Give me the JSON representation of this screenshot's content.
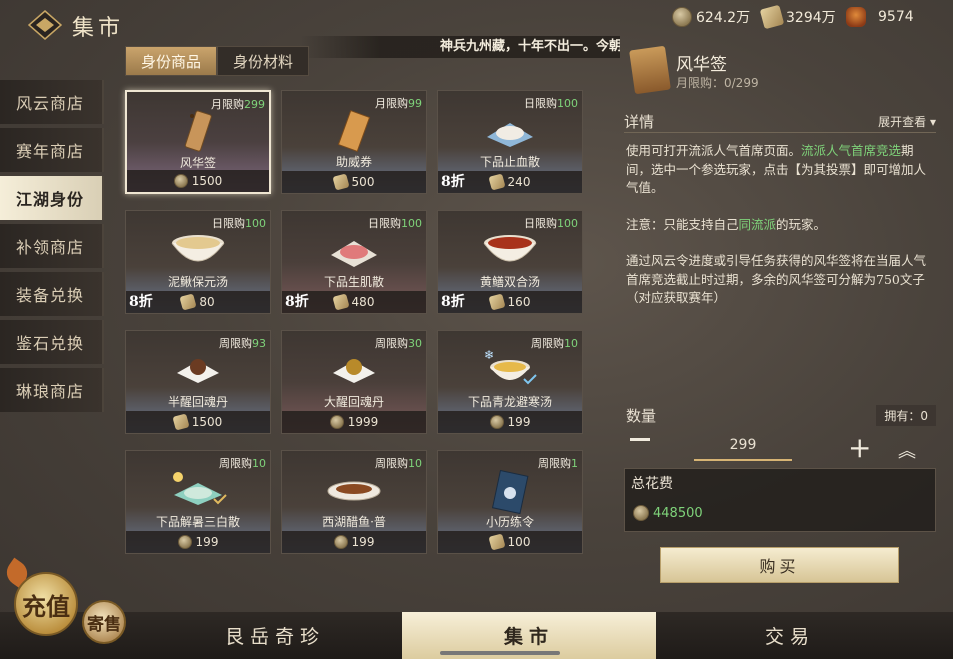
{
  "header": {
    "title": "集市",
    "currencies": [
      {
        "icon": "coin-icon",
        "value": "624.2万"
      },
      {
        "icon": "ticket-icon",
        "value": "3294万"
      },
      {
        "icon": "bag-icon",
        "value": "9574"
      }
    ]
  },
  "marquee": "神兵九州藏，十年不出一。今朝石破天惊",
  "sidebar": {
    "items": [
      {
        "label": "风云商店"
      },
      {
        "label": "赛年商店"
      },
      {
        "label": "江湖身份",
        "active": true
      },
      {
        "label": "补领商店"
      },
      {
        "label": "装备兑换"
      },
      {
        "label": "鉴石兑换"
      },
      {
        "label": "琳琅商店"
      }
    ]
  },
  "tabs": [
    {
      "label": "身份商品",
      "active": true
    },
    {
      "label": "身份材料"
    }
  ],
  "items": [
    {
      "name": "风华签",
      "limit_label": "月限购",
      "limit": "299",
      "price": "1500",
      "currency": "coin",
      "discount": "",
      "icon": "tag-icon",
      "selected": true
    },
    {
      "name": "助威券",
      "limit_label": "月限购",
      "limit": "99",
      "price": "500",
      "currency": "ticket",
      "discount": "",
      "icon": "voucher-icon"
    },
    {
      "name": "下品止血散",
      "limit_label": "日限购",
      "limit": "100",
      "price": "240",
      "currency": "ticket",
      "discount": "8折",
      "icon": "powder-white-icon"
    },
    {
      "name": "泥鳅保元汤",
      "limit_label": "日限购",
      "limit": "100",
      "price": "80",
      "currency": "ticket",
      "discount": "8折",
      "icon": "soup-bowl-icon"
    },
    {
      "name": "下品生肌散",
      "limit_label": "日限购",
      "limit": "100",
      "price": "480",
      "currency": "ticket",
      "discount": "8折",
      "icon": "powder-red-icon"
    },
    {
      "name": "黄鳝双合汤",
      "limit_label": "日限购",
      "limit": "100",
      "price": "160",
      "currency": "ticket",
      "discount": "8折",
      "icon": "soup-red-icon"
    },
    {
      "name": "半醒回魂丹",
      "limit_label": "周限购",
      "limit": "93",
      "price": "1500",
      "currency": "ticket",
      "discount": "",
      "icon": "pill-icon"
    },
    {
      "name": "大醒回魂丹",
      "limit_label": "周限购",
      "limit": "30",
      "price": "1999",
      "currency": "coin",
      "discount": "",
      "icon": "pill-gold-icon"
    },
    {
      "name": "下品青龙避寒汤",
      "limit_label": "周限购",
      "limit": "10",
      "price": "199",
      "currency": "coin",
      "discount": "",
      "icon": "soup-gold-icon"
    },
    {
      "name": "下品解暑三白散",
      "limit_label": "周限购",
      "limit": "10",
      "price": "199",
      "currency": "coin",
      "discount": "",
      "icon": "powder-green-icon"
    },
    {
      "name": "西湖醋鱼·普",
      "limit_label": "周限购",
      "limit": "10",
      "price": "199",
      "currency": "coin",
      "discount": "",
      "icon": "fish-dish-icon"
    },
    {
      "name": "小历练令",
      "limit_label": "周限购",
      "limit": "1",
      "price": "100",
      "currency": "scroll",
      "discount": "",
      "icon": "book-icon"
    }
  ],
  "detail": {
    "name": "风华签",
    "monthly": "月限购：0/299",
    "section_label": "详情",
    "expand_label": "展开查看",
    "desc_1_pre": "使用可打开流派人气首席页面。",
    "desc_1_hl": "流派人气首席竞选",
    "desc_1_post": "期间，选中一个参选玩家，点击【为其投票】即可增加人气值。",
    "desc_2_pre": "注意：只能支持自己",
    "desc_2_hl": "同流派",
    "desc_2_post": "的玩家。",
    "desc_3": "通过风云令进度或引导任务获得的风华签将在当届人气首席竞选截止时过期，多余的风华签可分解为750文子（对应获取赛年）",
    "qty_label": "数量",
    "own_label": "拥有：0",
    "qty": "299",
    "total_label": "总花费",
    "total": "448500",
    "buy_label": "购买"
  },
  "bottom_nav": [
    {
      "label": "艮岳奇珍"
    },
    {
      "label": "集市",
      "active": true
    },
    {
      "label": "交易"
    }
  ],
  "recharge_label": "充值",
  "consign_label": "寄售"
}
